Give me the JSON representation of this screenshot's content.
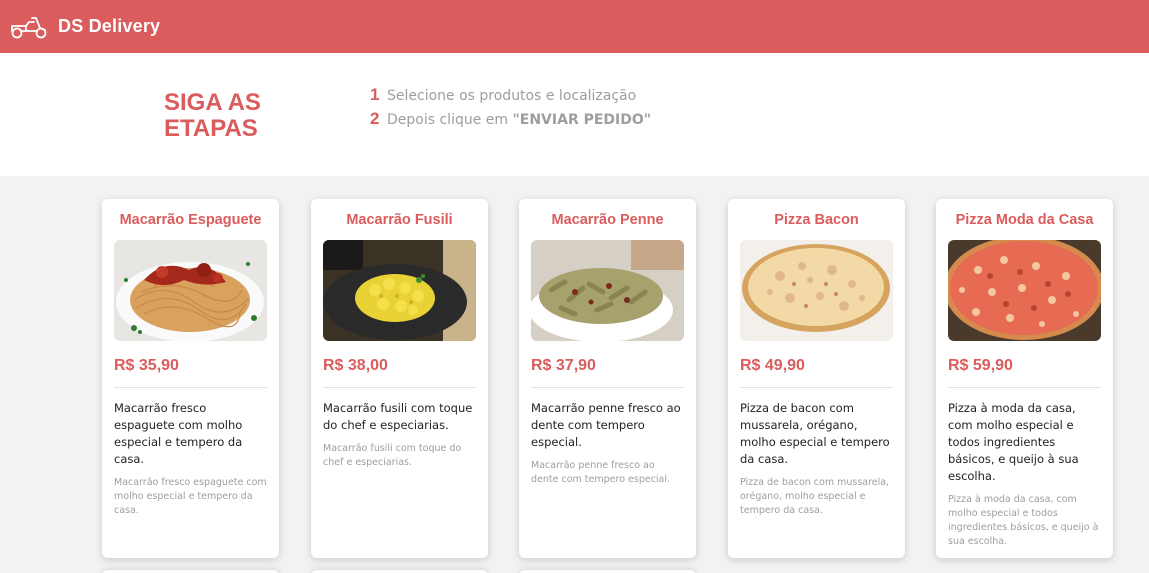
{
  "navbar": {
    "brand": "DS Delivery",
    "logo_icon": "scooter-icon",
    "color": "#da5c5c"
  },
  "steps": {
    "title_line1": "SIGA AS",
    "title_line2": "ETAPAS",
    "items": [
      {
        "num": "1",
        "text": "Selecione os produtos e localização",
        "strong": ""
      },
      {
        "num": "2",
        "text": "Depois clique em ",
        "strong": "\"ENVIAR PEDIDO\""
      }
    ]
  },
  "products": [
    {
      "name": "Macarrão Espaguete",
      "price": "R$ 35,90",
      "description": "Macarrão fresco espaguete com molho especial e tempero da casa.",
      "small": "Macarrão fresco espaguete com molho especial e tempero da casa."
    },
    {
      "name": "Macarrão Fusili",
      "price": "R$ 38,00",
      "description": "Macarrão fusili com toque do chef e especiarias.",
      "small": "Macarrão fusili com toque do chef e especiarias."
    },
    {
      "name": "Macarrão Penne",
      "price": "R$ 37,90",
      "description": "Macarrão penne fresco ao dente com tempero especial.",
      "small": "Macarrão penne fresco ao dente com tempero especial."
    },
    {
      "name": "Pizza Bacon",
      "price": "R$ 49,90",
      "description": "Pizza de bacon com mussarela, orégano, molho especial e tempero da casa.",
      "small": "Pizza de bacon com mussarela, orégano, molho especial e tempero da casa."
    },
    {
      "name": "Pizza Moda da Casa",
      "price": "R$ 59,90",
      "description": "Pizza à moda da casa, com molho especial e todos ingredientes básicos, e queijo à sua escolha.",
      "small": "Pizza à moda da casa, com molho especial e todos ingredientes básicos, e queijo à sua escolha."
    }
  ]
}
